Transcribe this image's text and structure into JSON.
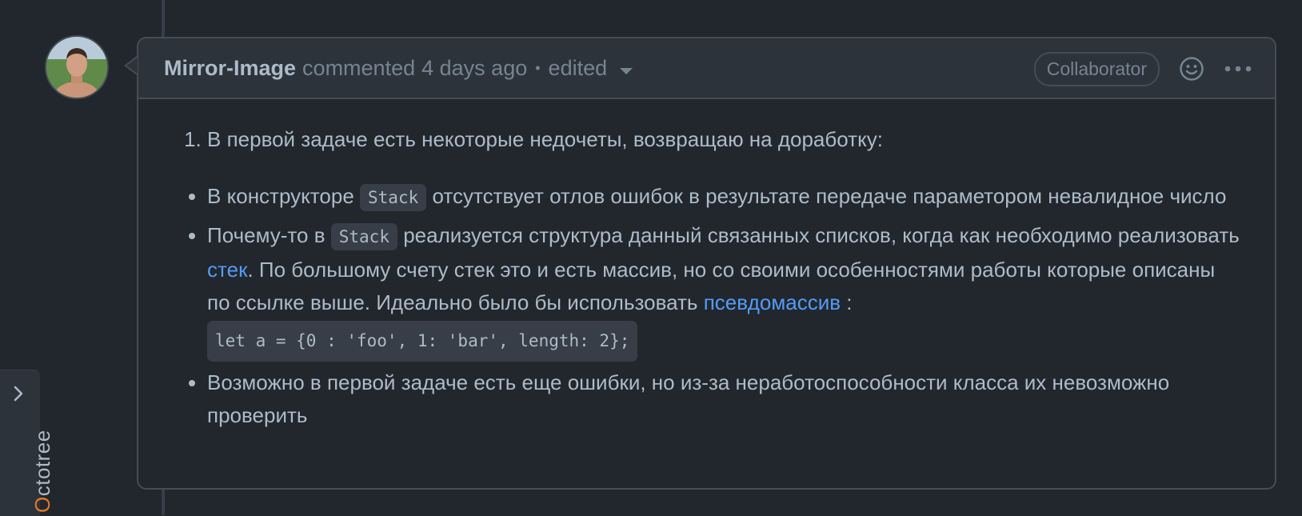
{
  "comment": {
    "author": "Mirror-Image",
    "action": "commented",
    "time": "4 days ago",
    "separator": "•",
    "edited": "edited",
    "role": "Collaborator",
    "icons": {
      "reaction": "smiley-icon",
      "more": "kebab-horizontal-icon",
      "edited_menu": "triangle-down-icon"
    },
    "body": {
      "ordered_item": "В первой задаче есть некоторые недочеты, возвращаю на доработку:",
      "bullets": [
        {
          "pre": "В конструкторе ",
          "code": "Stack",
          "post": " отсутствует отлов ошибок в результате передаче параметором невалидное число"
        },
        {
          "pre": "Почему-то в ",
          "code": "Stack",
          "mid": " реализуется структура данный связанных списков, когда как необходимо реализовать ",
          "link1": "стек",
          "mid2": ". По большому счету стек это и есть массив, но со своими особенностями работы которые описаны по ссылке выше. Идеально было бы использовать ",
          "link2": "псевдомассив",
          "mid3": " :",
          "code2": "let a = {0 : 'foo', 1: 'bar', length: 2};"
        },
        {
          "text": "Возможно в первой задаче есть еще ошибки, но из-за неработоспособности класса их невозможно проверить"
        }
      ]
    }
  },
  "octotree": {
    "label_first": "O",
    "label_rest": "ctotree",
    "icon": "chevron-right-icon"
  },
  "colors": {
    "background": "#22272e",
    "header": "#2d333b",
    "border": "#444c56",
    "text": "#adbac7",
    "muted": "#768390",
    "link": "#539bf5",
    "octotree_accent": "#e8772e"
  }
}
